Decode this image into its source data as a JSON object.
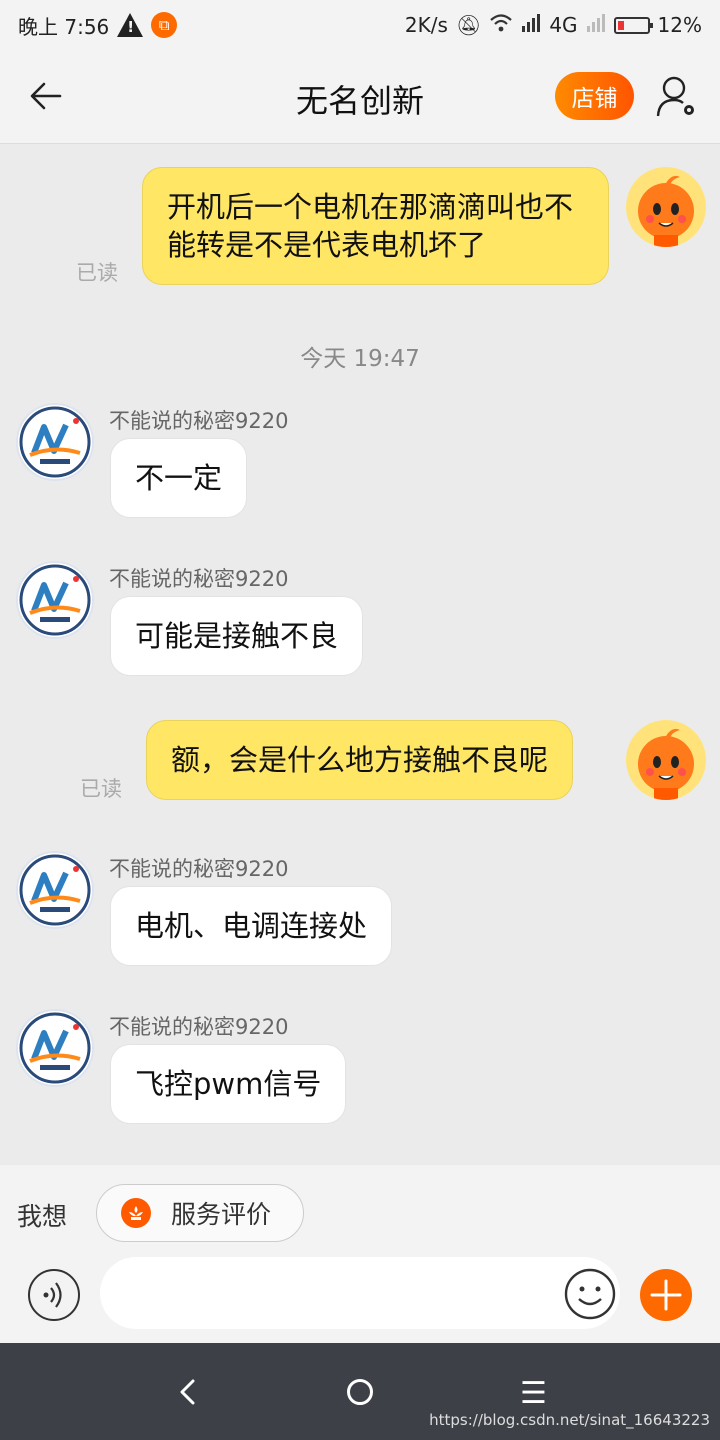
{
  "status_bar": {
    "time": "晚上 7:56",
    "net_speed": "2K/s",
    "network_type": "4G",
    "battery": "12%",
    "icons": [
      "warning-icon",
      "app-notification-icon",
      "mute-icon",
      "wifi-icon",
      "signal-icon",
      "battery-icon"
    ]
  },
  "header": {
    "title": "无名创新",
    "shop_label": "店铺"
  },
  "chat": {
    "time_divider": "今天  19:47",
    "read_label": "已读",
    "sender_name": "不能说的秘密9220",
    "messages": [
      {
        "from": "me",
        "text": "开机后一个电机在那滴滴叫也不能转是不是代表电机坏了",
        "read": "已读"
      },
      {
        "from": "them",
        "sender": "不能说的秘密9220",
        "text": "不一定"
      },
      {
        "from": "them",
        "sender": "不能说的秘密9220",
        "text": "可能是接触不良"
      },
      {
        "from": "me",
        "text": "额，会是什么地方接触不良呢",
        "read": "已读"
      },
      {
        "from": "them",
        "sender": "不能说的秘密9220",
        "text": "电机、电调连接处"
      },
      {
        "from": "them",
        "sender": "不能说的秘密9220",
        "text": "飞控pwm信号"
      }
    ]
  },
  "quick_bar": {
    "label": "我想",
    "rate_button": "服务评价"
  },
  "input_bar": {
    "placeholder": ""
  },
  "watermark": "https://blog.csdn.net/sinat_16643223",
  "colors": {
    "accent": "#ff6a00",
    "my_bubble": "#ffe665",
    "their_bubble": "#ffffff",
    "background": "#ebebeb"
  }
}
